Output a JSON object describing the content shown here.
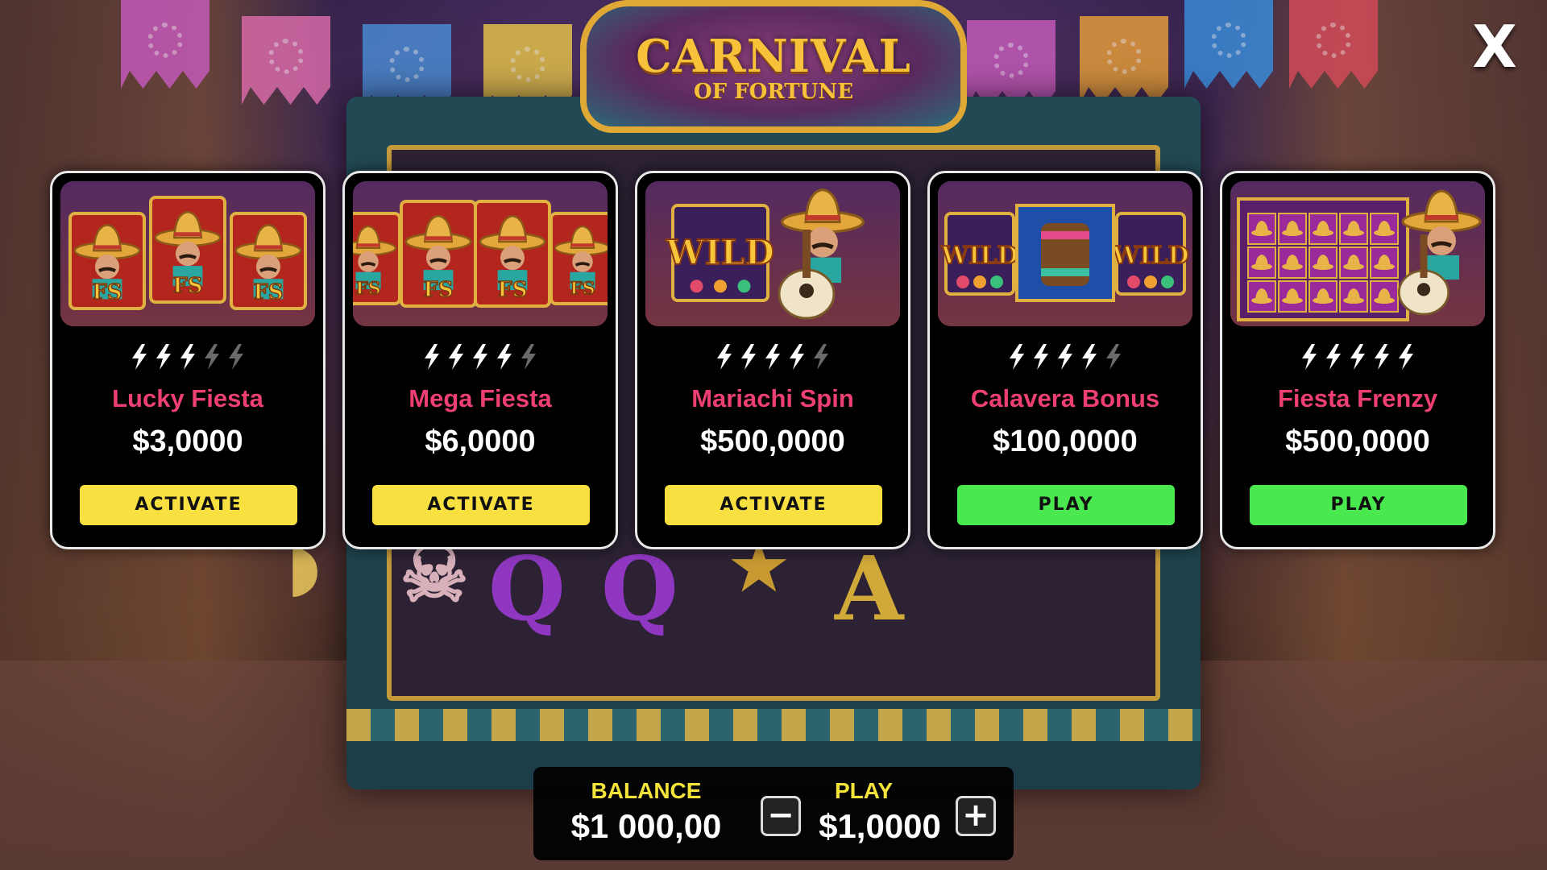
{
  "header": {
    "logo_line1": "CARNIVAL",
    "logo_line2": "OF FORTUNE",
    "close_label": "X"
  },
  "cards": [
    {
      "name": "Lucky Fiesta",
      "prize": "$3,0000",
      "button": "ACTIVATE",
      "button_type": "activate",
      "bolts_total": 5,
      "bolts_lit": 3,
      "thumbnail": "three-mariachi-fs-symbols"
    },
    {
      "name": "Mega Fiesta",
      "prize": "$6,0000",
      "button": "ACTIVATE",
      "button_type": "activate",
      "bolts_total": 5,
      "bolts_lit": 4,
      "thumbnail": "four-mariachi-fs-symbols"
    },
    {
      "name": "Mariachi Spin",
      "prize": "$500,0000",
      "button": "ACTIVATE",
      "button_type": "activate",
      "bolts_total": 5,
      "bolts_lit": 4,
      "thumbnail": "wild-and-guitar-mariachi"
    },
    {
      "name": "Calavera Bonus",
      "prize": "$100,0000",
      "button": "PLAY",
      "button_type": "play",
      "bolts_total": 5,
      "bolts_lit": 4,
      "thumbnail": "wild-drum-wild"
    },
    {
      "name": "Fiesta Frenzy",
      "prize": "$500,0000",
      "button": "PLAY",
      "button_type": "play",
      "bolts_total": 5,
      "bolts_lit": 5,
      "thumbnail": "sombrero-grid-mariachi"
    }
  ],
  "bottom_bar": {
    "balance_label": "BALANCE",
    "balance_value": "$1 000,00",
    "play_label": "PLAY",
    "play_value": "$1,0000",
    "minus_label": "−",
    "plus_label": "+"
  },
  "colors": {
    "activate_button": "#f9e041",
    "play_button": "#48e84e",
    "game_name": "#ee3f72",
    "bolt_lit": "#ffffff",
    "bolt_dim": "#6a6a6a",
    "bar_label": "#f4e43a"
  }
}
